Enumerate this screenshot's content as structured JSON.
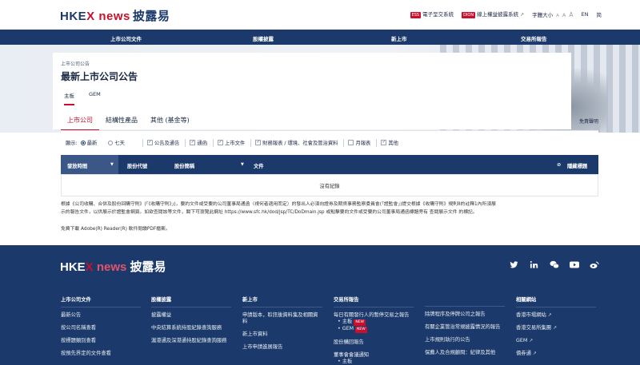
{
  "header": {
    "logo_hkex_a": "HKE",
    "logo_hkex_x": "X",
    "logo_news": "news",
    "logo_cn": "披露易",
    "link_ess_tag": "ESS",
    "link_ess": "電子呈交系統",
    "link_dion_tag": "DION",
    "link_dion": "線上權益披露系統",
    "font_size_label": "字體大小",
    "font_sizes": [
      "A",
      "A",
      "A"
    ],
    "lang_en": "EN",
    "lang_sc": "简"
  },
  "nav": {
    "items": [
      "上市公司文件",
      "股權披露",
      "新上市",
      "交易所報告"
    ]
  },
  "page": {
    "breadcrumb": "上市公司公告",
    "title": "最新上市公司公告",
    "market_tabs": [
      "主板",
      "GEM"
    ],
    "category_tabs": [
      "上市公司",
      "結構性產品",
      "其他 (基金等)"
    ],
    "help_link": "免責聲明"
  },
  "filters": {
    "display_label": "顯示:",
    "radio_latest": "最新",
    "radio_seven": "七天",
    "checkboxes": [
      {
        "label": "公告及通告",
        "checked": true
      },
      {
        "label": "通函",
        "checked": true
      },
      {
        "label": "上市文件",
        "checked": true
      },
      {
        "label": "財務報表 / 環境、社會及管治資料",
        "checked": true
      },
      {
        "label": "月報表",
        "checked": false
      },
      {
        "label": "其他",
        "checked": true
      }
    ]
  },
  "table": {
    "columns": [
      "發放時間",
      "股份代號",
      "股份簡稱",
      "文件"
    ],
    "hide_label": "隱藏標題",
    "empty_text": "沒有紀錄"
  },
  "notes": {
    "line1": "根據《公司收購、合併及股份回購守則》(「《收購守則》」)，要約文件或受要約公司董事局通函（視何者適用而定）的發出人必須向證券及期貨事務監察委員會(「證監會」)提交根據《收購守則》規則8的註釋1內所須展",
    "line2": "示的報告文件，以供展示於證監會網頁。如欲查閱該等文件，閣下可瀏覽此網址 https://www.sfc.hk/dod/jsp/TC/DoDmain.jsp 或點擊要約文件或受要約公司董事局通函標題旁有 查閱展示文件 的標記。",
    "line3": "免費下載 Adobe(R) Reader(R) 軟件閱讀PDF檔案。"
  },
  "footer": {
    "columns": [
      {
        "heading": "上市公司文件",
        "items": [
          "最新公告",
          "按公司名稱查看",
          "按標題類別查看",
          "按預先界定的文件查看"
        ]
      },
      {
        "heading": "股權披露",
        "items": [
          "披露權益",
          "中央結算系統持股紀錄查詢服務",
          "滬港通及深港通持股紀錄查詢服務"
        ]
      },
      {
        "heading": "新上市",
        "items": [
          "申請版本，聆訊後資料集及相關資料",
          "新上市資料",
          "上市申請進展報告"
        ]
      },
      {
        "heading": "交易所報告",
        "items": [
          "每日有關發行人的暫停交易之報告",
          "主板",
          "GEM",
          "股份購回報告",
          "董事會會議通知",
          "主板"
        ]
      },
      {
        "heading": "",
        "items": [
          "除牌程序及停牌公司之報告",
          "有關企業管治常規披露情況的報告",
          "上市規則執行的公告",
          "保薦人及合規顧問：紀律及其他"
        ]
      },
      {
        "heading": "相關網站",
        "items": [
          "香港市場網站",
          "香港交易所集團",
          "GEM",
          "債券通"
        ]
      }
    ],
    "new_badge": "NEW"
  }
}
